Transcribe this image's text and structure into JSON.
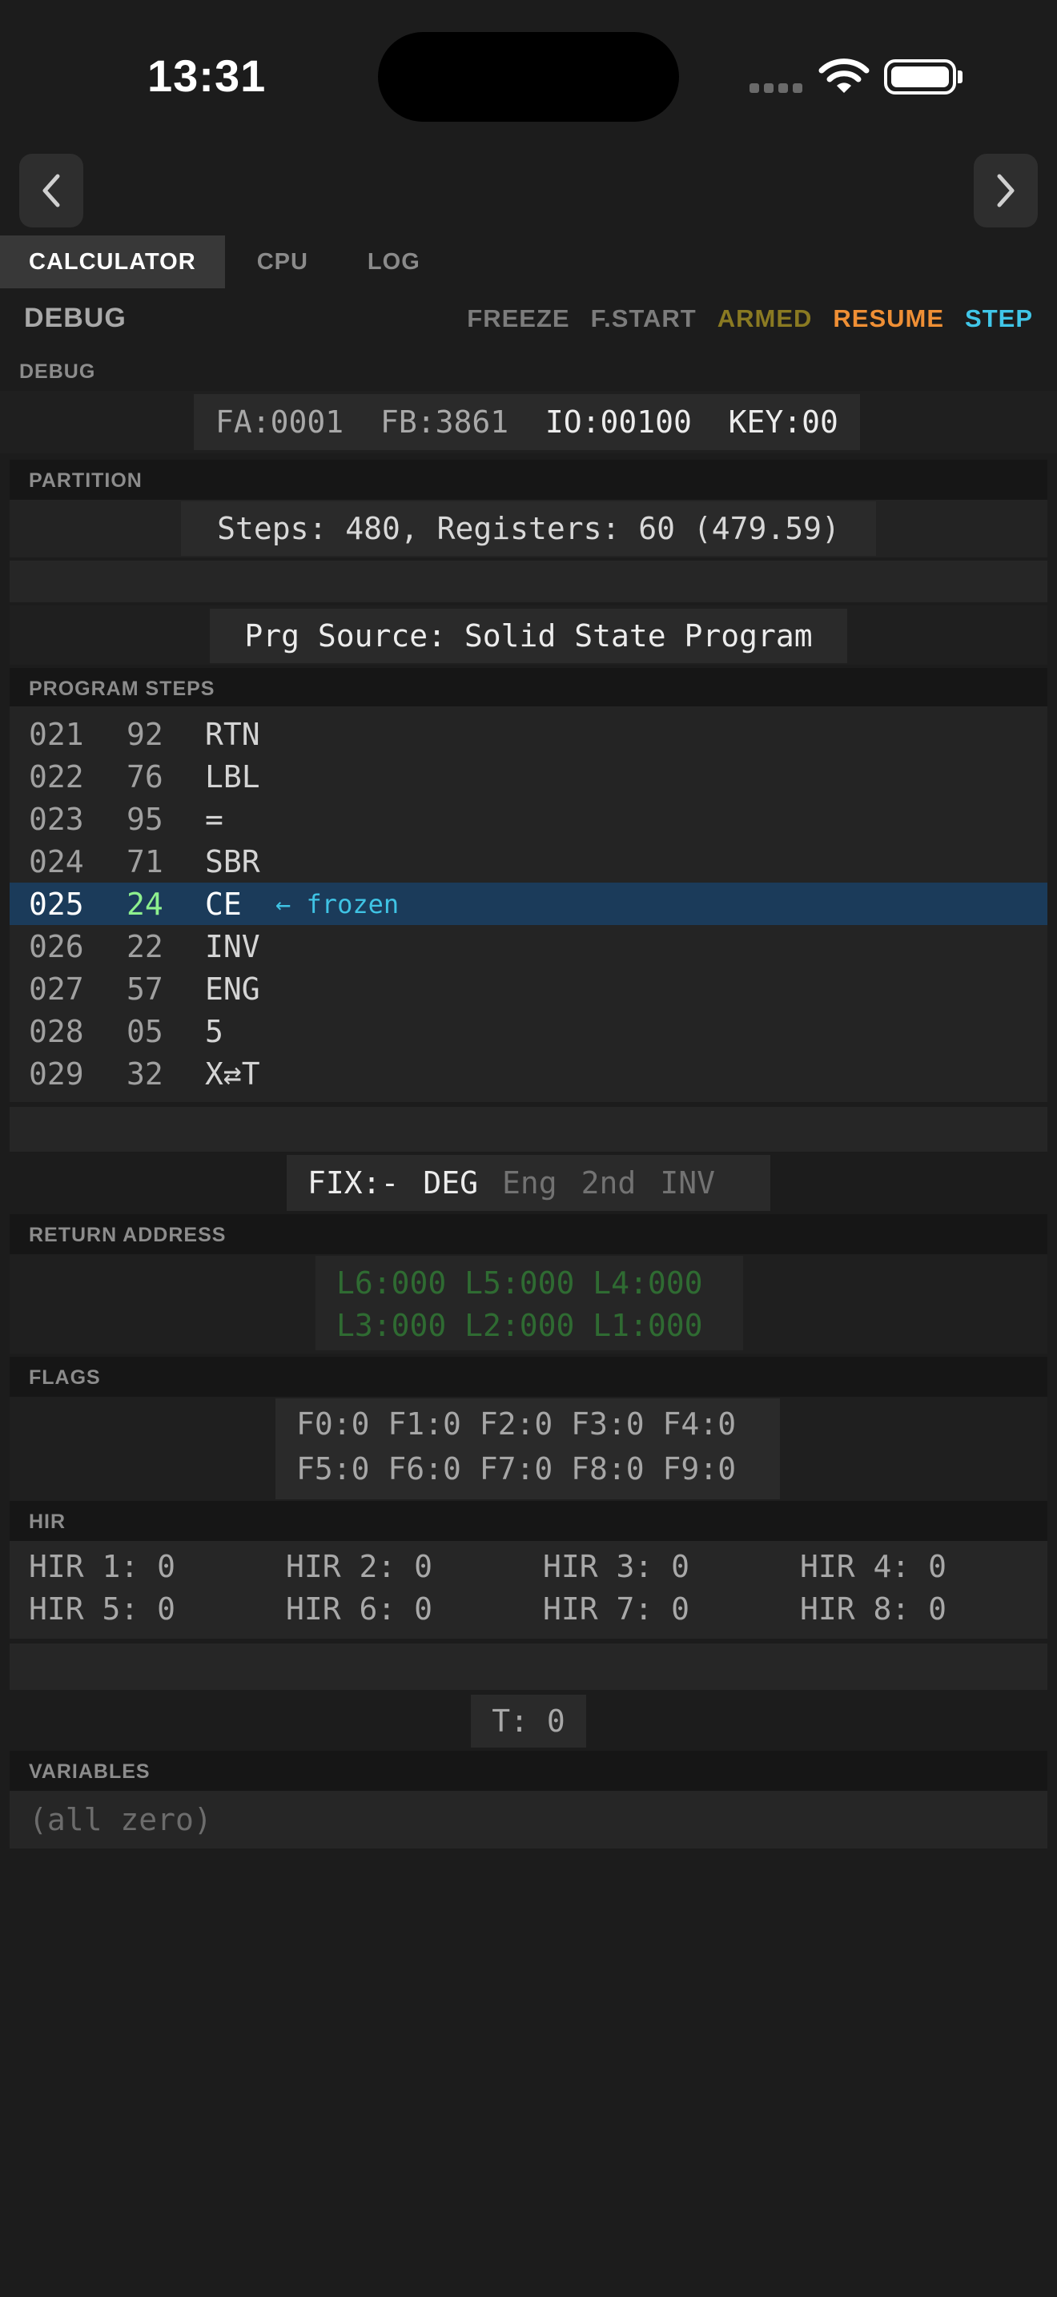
{
  "status_bar": {
    "time": "13:31"
  },
  "tabs": [
    "CALCULATOR",
    "CPU",
    "LOG"
  ],
  "debug": {
    "title": "DEBUG",
    "actions": {
      "freeze": "FREEZE",
      "fstart": "F.START",
      "armed": "ARMED",
      "resume": "RESUME",
      "step": "STEP"
    },
    "colors": {
      "armed": "#8a7a22",
      "resume": "#ef8f35",
      "step": "#40c6e8"
    }
  },
  "registers": {
    "label": "DEBUG",
    "fa": "FA:0001",
    "fb": "FB:3861",
    "io": "IO:00100",
    "key": "KEY:00"
  },
  "partition": {
    "label": "PARTITION",
    "text": "Steps: 480, Registers: 60 (479.59)"
  },
  "prg_source": "Prg Source: Solid State Program",
  "program_steps": {
    "label": "PROGRAM STEPS",
    "rows": [
      {
        "addr": "021",
        "code": "92",
        "mnemonic": "RTN"
      },
      {
        "addr": "022",
        "code": "76",
        "mnemonic": "LBL"
      },
      {
        "addr": "023",
        "code": "95",
        "mnemonic": "="
      },
      {
        "addr": "024",
        "code": "71",
        "mnemonic": "SBR"
      },
      {
        "addr": "025",
        "code": "24",
        "mnemonic": "CE",
        "note": "← frozen"
      },
      {
        "addr": "026",
        "code": "22",
        "mnemonic": "INV"
      },
      {
        "addr": "027",
        "code": "57",
        "mnemonic": "ENG"
      },
      {
        "addr": "028",
        "code": "05",
        "mnemonic": "5"
      },
      {
        "addr": "029",
        "code": "32",
        "mnemonic": "X⇄T"
      }
    ]
  },
  "modes": {
    "fix": "FIX:-",
    "deg": "DEG",
    "eng": "Eng",
    "second": "2nd",
    "inv": "INV"
  },
  "return_address": {
    "label": "RETURN ADDRESS",
    "line1": "L6:000 L5:000 L4:000",
    "line2": "L3:000 L2:000 L1:000"
  },
  "flags": {
    "label": "FLAGS",
    "line1": "F0:0 F1:0 F2:0 F3:0 F4:0",
    "line2": "F5:0 F6:0 F7:0 F8:0 F9:0"
  },
  "hir": {
    "label": "HIR",
    "items": [
      "HIR 1: 0",
      "HIR 2: 0",
      "HIR 3: 0",
      "HIR 4: 0",
      "HIR 5: 0",
      "HIR 6: 0",
      "HIR 7: 0",
      "HIR 8: 0"
    ]
  },
  "t_register": "T: 0",
  "variables": {
    "label": "VARIABLES",
    "empty_text": "(all zero)"
  }
}
